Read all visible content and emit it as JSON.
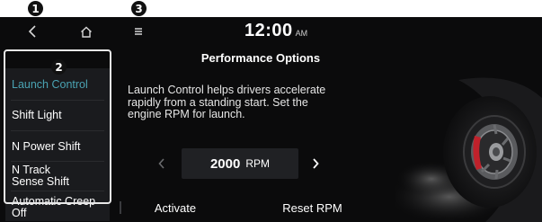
{
  "callouts": [
    "1",
    "2",
    "3"
  ],
  "status_bar": {
    "back_icon": "chevron-left-icon",
    "home_icon": "home-icon",
    "menu_icon": "hamburger-menu-icon",
    "time": "12:00",
    "ampm": "AM"
  },
  "page": {
    "title": "Performance Options"
  },
  "sidebar": {
    "items": [
      {
        "label_lines": [
          "Launch Control"
        ],
        "selected": true
      },
      {
        "label_lines": [
          "Shift Light"
        ],
        "selected": false
      },
      {
        "label_lines": [
          "N Power Shift"
        ],
        "selected": false
      },
      {
        "label_lines": [
          "N Track",
          "Sense Shift"
        ],
        "selected": false
      },
      {
        "label_lines": [
          "Automatic Creep",
          "Off"
        ],
        "selected": false
      }
    ]
  },
  "main": {
    "description_lines": [
      "Launch Control helps drivers accelerate",
      "rapidly from a standing start. Set the",
      "engine RPM for launch."
    ],
    "rpm": {
      "value": "2000",
      "unit": "RPM"
    },
    "buttons": {
      "activate": "Activate",
      "reset": "Reset RPM"
    }
  },
  "colors": {
    "background": "#0b0b0c",
    "sidebar": "#1a1b1e",
    "selected_text": "#4aa3b3",
    "text": "#ffffff",
    "brake_caliper": "#c0212b"
  }
}
